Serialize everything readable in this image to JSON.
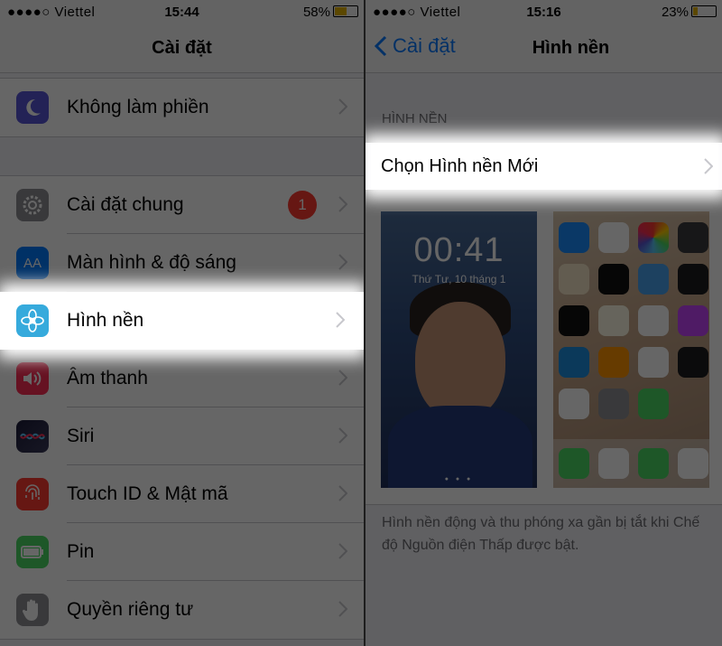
{
  "left_screen": {
    "status": {
      "carrier": "●●●●○ Viettel",
      "time": "15:44",
      "battery": "58%"
    },
    "nav_title": "Cài đặt",
    "items": [
      {
        "label": "Không làm phiền",
        "icon": "moon-icon",
        "color": "#5856d6"
      },
      {
        "label": "Cài đặt chung",
        "icon": "gear-icon",
        "color": "#8e8e93",
        "badge": "1"
      },
      {
        "label": "Màn hình & độ sáng",
        "icon": "display-brightness-icon",
        "color": "#007aff",
        "icon_text": "AA"
      },
      {
        "label": "Hình nền",
        "icon": "wallpaper-flower-icon",
        "color": "#36aadc"
      },
      {
        "label": "Âm thanh",
        "icon": "speaker-icon",
        "color": "#ff2d55"
      },
      {
        "label": "Siri",
        "icon": "siri-icon",
        "color": "#333333"
      },
      {
        "label": "Touch ID & Mật mã",
        "icon": "fingerprint-icon",
        "color": "#ff3b30"
      },
      {
        "label": "Pin",
        "icon": "battery-icon",
        "color": "#4cd964"
      },
      {
        "label": "Quyền riêng tư",
        "icon": "hand-icon",
        "color": "#8e8e93"
      }
    ],
    "highlighted": "Hình nền"
  },
  "right_screen": {
    "status": {
      "carrier": "●●●●○ Viettel",
      "time": "15:16",
      "battery": "23%"
    },
    "back_label": "Cài đặt",
    "nav_title": "Hình nền",
    "section_header": "HÌNH NỀN",
    "choose_label": "Chọn Hình nền Mới",
    "lock_preview": {
      "time": "00:41",
      "date": "Thứ Tư, 10 tháng 1"
    },
    "footer": "Hình nền động và thu phóng xa gần bị tắt khi Chế độ Nguồn điện Thấp được bật."
  }
}
